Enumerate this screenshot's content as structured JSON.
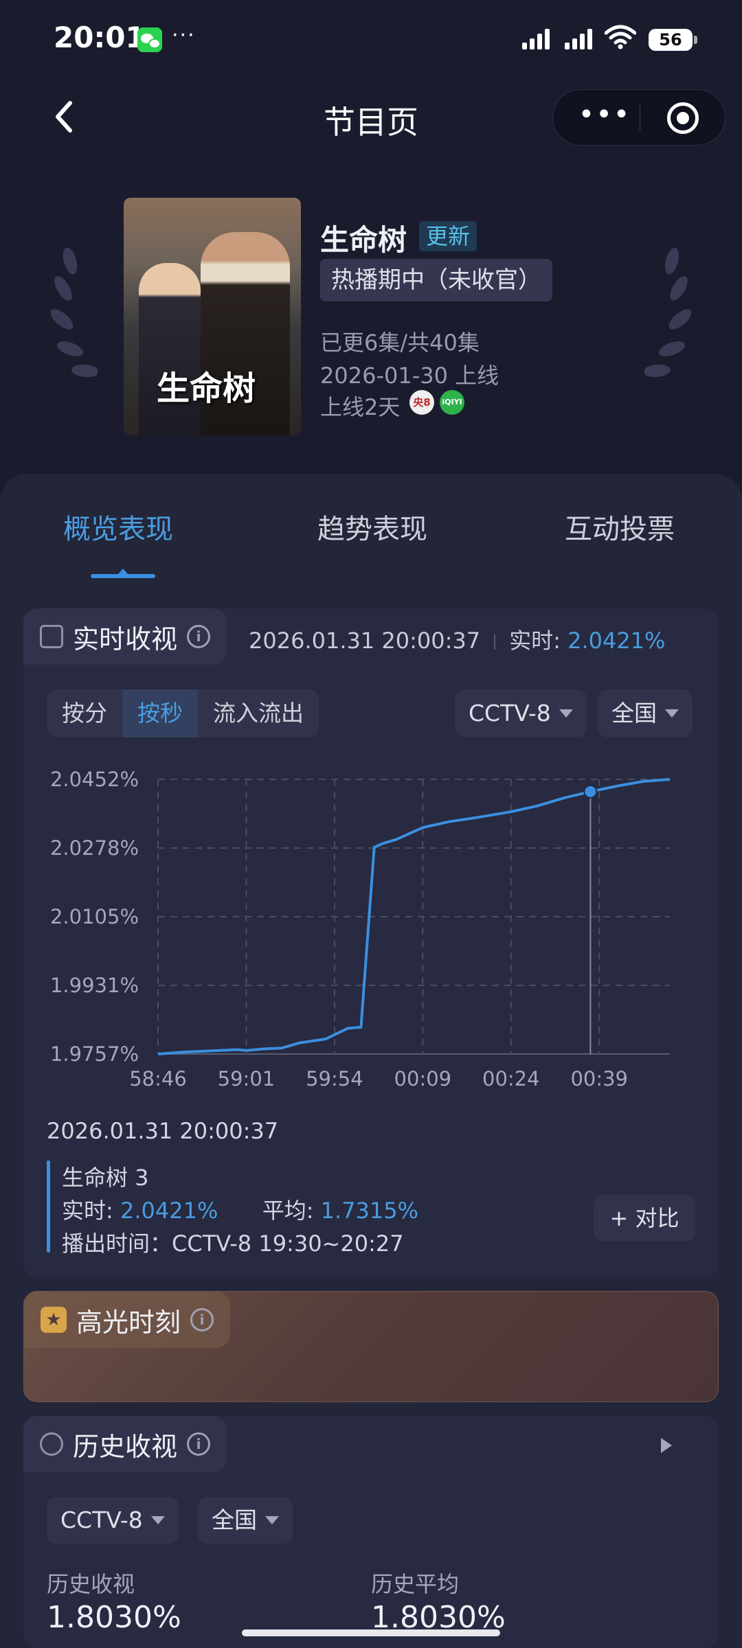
{
  "status_bar": {
    "time": "20:01",
    "dots": "···",
    "battery": "56"
  },
  "nav": {
    "title": "节目页",
    "more_label": "•••"
  },
  "show": {
    "poster_title": "生命树",
    "name": "生命树",
    "update_badge": "更新",
    "status": "热播期中（未收官）",
    "episodes": "已更6集/共40集",
    "premiere": "2026-01-30 上线",
    "days_online": "上线2天",
    "channel_icons": [
      "央8",
      "iQIYI"
    ]
  },
  "tabs": [
    {
      "label": "概览表现",
      "active": true
    },
    {
      "label": "趋势表现",
      "active": false
    },
    {
      "label": "互动投票",
      "active": false
    }
  ],
  "realtime": {
    "title": "实时收视",
    "timestamp": "2026.01.31 20:00:37",
    "realtime_label": "实时:",
    "realtime_value": "2.0421%",
    "segments": [
      "按分",
      "按秒",
      "流入流出"
    ],
    "active_segment": "按秒",
    "channel": "CCTV-8",
    "region": "全国"
  },
  "chart_data": {
    "type": "line",
    "title": "",
    "xlabel": "",
    "ylabel": "",
    "x_ticks": [
      "58:46",
      "59:01",
      "59:54",
      "00:09",
      "00:24",
      "00:39"
    ],
    "y_ticks": [
      "1.9757%",
      "1.9931%",
      "2.0105%",
      "2.0278%",
      "2.0452%"
    ],
    "ylim": [
      1.9757,
      2.0452
    ],
    "grid": true,
    "series": [
      {
        "color": "#3b8fe0",
        "x": [
          0,
          0.3,
          0.6,
          0.9,
          1.0,
          1.2,
          1.4,
          1.6,
          1.9,
          2.15,
          2.3,
          2.45,
          2.55,
          2.7,
          3.0,
          3.3,
          3.6,
          4.0,
          4.3,
          4.6,
          4.9,
          5.2,
          5.5,
          5.8
        ],
        "y": [
          1.9757,
          1.9762,
          1.9765,
          1.9768,
          1.9766,
          1.977,
          1.9772,
          1.9785,
          1.9795,
          1.9822,
          1.9825,
          2.028,
          2.029,
          2.03,
          2.033,
          2.0345,
          2.0355,
          2.037,
          2.0385,
          2.0405,
          2.0421,
          2.0435,
          2.0447,
          2.0452
        ]
      }
    ],
    "marker": {
      "x": 4.9,
      "y": 2.0421
    }
  },
  "detail": {
    "date": "2026.01.31 20:00:37",
    "show_line": "生命树 3",
    "realtime_label": "实时:",
    "realtime_value": "2.0421%",
    "avg_label": "平均:",
    "avg_value": "1.7315%",
    "airtime": "播出时间：CCTV-8 19:30~20:27",
    "compare_button": "+ 对比"
  },
  "highlight": {
    "title": "高光时刻"
  },
  "history": {
    "title": "历史收视",
    "channel": "CCTV-8",
    "region": "全国",
    "label_left": "历史收视",
    "value_left": "1.8030%",
    "label_right": "历史平均",
    "value_right": "1.8030%"
  }
}
